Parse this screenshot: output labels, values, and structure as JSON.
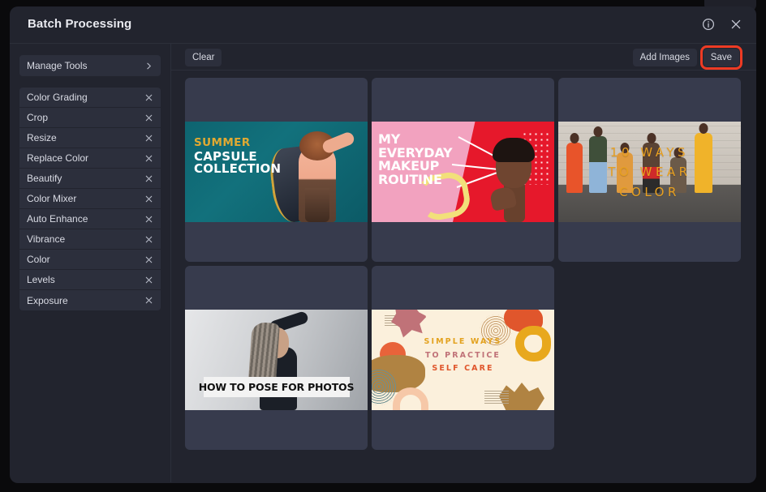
{
  "window": {
    "title": "Batch Processing"
  },
  "header": {
    "info_icon": "info-circle-icon",
    "close_icon": "close-icon"
  },
  "sidebar": {
    "manage_tools": {
      "label": "Manage Tools",
      "chevron_icon": "chevron-right-icon"
    },
    "remove_icon": "close-icon",
    "tools": [
      {
        "label": "Color Grading"
      },
      {
        "label": "Crop"
      },
      {
        "label": "Resize"
      },
      {
        "label": "Replace Color"
      },
      {
        "label": "Beautify"
      },
      {
        "label": "Color Mixer"
      },
      {
        "label": "Auto Enhance"
      },
      {
        "label": "Vibrance"
      },
      {
        "label": "Color"
      },
      {
        "label": "Levels"
      },
      {
        "label": "Exposure"
      }
    ]
  },
  "toolbar": {
    "clear_label": "Clear",
    "add_images_label": "Add Images",
    "save_label": "Save",
    "save_highlight_color": "#ee3b24"
  },
  "gallery": {
    "items": [
      {
        "id": "summer-capsule-collection",
        "lines": [
          "SUMMER",
          "CAPSULE",
          "COLLECTION"
        ],
        "colors": {
          "background": "#0e6470",
          "accent": "#e0a932",
          "text": "#ffffff"
        }
      },
      {
        "id": "my-everyday-makeup-routine",
        "lines": [
          "MY",
          "EVERYDAY",
          "MAKEUP",
          "ROUTINE"
        ],
        "colors": {
          "background": "#f2a2bf",
          "accent": "#e6182b",
          "text": "#ffffff"
        }
      },
      {
        "id": "10-ways-to-wear-color",
        "lines": [
          "10 WAYS",
          "TO WEAR",
          "COLOR"
        ],
        "colors": {
          "background": "#c7c0b8",
          "accent": "#e8a020",
          "text": "#e8a020"
        }
      },
      {
        "id": "how-to-pose-for-photos",
        "lines": [
          "HOW TO POSE FOR PHOTOS"
        ],
        "colors": {
          "background": "#cfd1d4",
          "accent": "#f3f3f3",
          "text": "#111111"
        }
      },
      {
        "id": "simple-ways-to-practice-self-care",
        "lines": [
          "SIMPLE WAYS",
          "TO PRACTICE",
          "SELF CARE"
        ],
        "colors": {
          "background": "#fbf0dc",
          "accent": "#e3a21f",
          "text": "#e0562c"
        }
      }
    ]
  },
  "theme": {
    "page_background": "#0a0a0c",
    "modal_background": "#22242e",
    "panel_background": "#2c2f3c",
    "card_background": "#373b4d",
    "text_primary": "#e9eaf0",
    "text_secondary": "#d9dbe4",
    "divider": "#2c2f3a"
  }
}
